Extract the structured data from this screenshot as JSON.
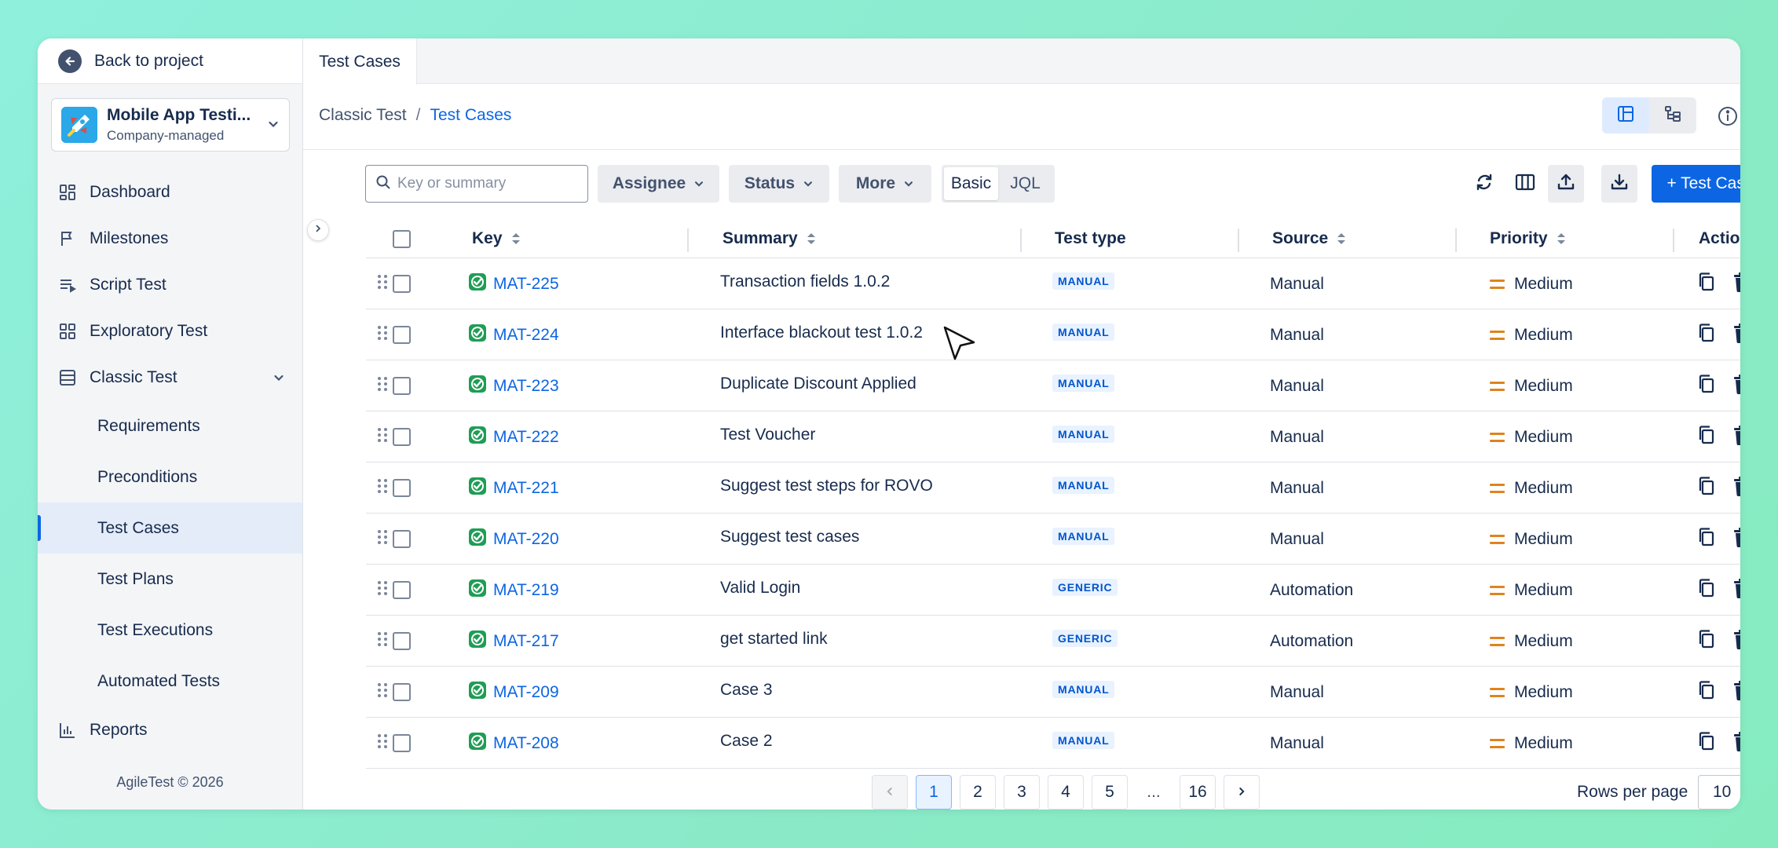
{
  "sidebar": {
    "back_label": "Back to project",
    "project": {
      "name": "Mobile App Testi...",
      "subtitle": "Company-managed"
    },
    "nav": [
      {
        "label": "Dashboard",
        "icon": "dashboard-icon"
      },
      {
        "label": "Milestones",
        "icon": "flag-icon"
      },
      {
        "label": "Script Test",
        "icon": "script-icon"
      },
      {
        "label": "Exploratory Test",
        "icon": "grid-icon"
      },
      {
        "label": "Classic Test",
        "icon": "table-icon",
        "expanded": true
      }
    ],
    "subnav": [
      {
        "label": "Requirements"
      },
      {
        "label": "Preconditions"
      },
      {
        "label": "Test Cases",
        "active": true
      },
      {
        "label": "Test Plans"
      },
      {
        "label": "Test Executions"
      },
      {
        "label": "Automated Tests"
      }
    ],
    "reports_label": "Reports",
    "copyright": "AgileTest © 2026"
  },
  "tabs": [
    {
      "label": "Test Cases",
      "active": true
    }
  ],
  "breadcrumb": {
    "parent": "Classic Test",
    "separator": "/",
    "current": "Test Cases"
  },
  "toolbar": {
    "search_placeholder": "Key or summary",
    "filters": [
      "Assignee",
      "Status",
      "More"
    ],
    "modes": [
      "Basic",
      "JQL"
    ],
    "active_mode": "Basic",
    "add_label": "+ Test Case"
  },
  "table": {
    "columns": [
      "Key",
      "Summary",
      "Test type",
      "Source",
      "Priority",
      "Action"
    ],
    "rows": [
      {
        "key": "MAT-225",
        "summary": "Transaction fields 1.0.2",
        "type": "MANUAL",
        "source": "Manual",
        "priority": "Medium"
      },
      {
        "key": "MAT-224",
        "summary": "Interface blackout test 1.0.2",
        "type": "MANUAL",
        "source": "Manual",
        "priority": "Medium"
      },
      {
        "key": "MAT-223",
        "summary": "Duplicate Discount Applied",
        "type": "MANUAL",
        "source": "Manual",
        "priority": "Medium"
      },
      {
        "key": "MAT-222",
        "summary": "Test Voucher",
        "type": "MANUAL",
        "source": "Manual",
        "priority": "Medium"
      },
      {
        "key": "MAT-221",
        "summary": "Suggest test steps for ROVO",
        "type": "MANUAL",
        "source": "Manual",
        "priority": "Medium"
      },
      {
        "key": "MAT-220",
        "summary": "Suggest test cases",
        "type": "MANUAL",
        "source": "Manual",
        "priority": "Medium"
      },
      {
        "key": "MAT-219",
        "summary": "Valid Login",
        "type": "GENERIC",
        "source": "Automation",
        "priority": "Medium"
      },
      {
        "key": "MAT-217",
        "summary": "get started link",
        "type": "GENERIC",
        "source": "Automation",
        "priority": "Medium"
      },
      {
        "key": "MAT-209",
        "summary": "Case 3",
        "type": "MANUAL",
        "source": "Manual",
        "priority": "Medium"
      },
      {
        "key": "MAT-208",
        "summary": "Case 2",
        "type": "MANUAL",
        "source": "Manual",
        "priority": "Medium"
      }
    ]
  },
  "pagination": {
    "pages": [
      "1",
      "2",
      "3",
      "4",
      "5"
    ],
    "ellipsis": "...",
    "last": "16",
    "current": "1",
    "rows_label": "Rows per page",
    "rows_value": "10"
  },
  "colors": {
    "accent": "#0c66e4",
    "priority_medium": "#e0831d",
    "check_green": "#22a06b"
  }
}
